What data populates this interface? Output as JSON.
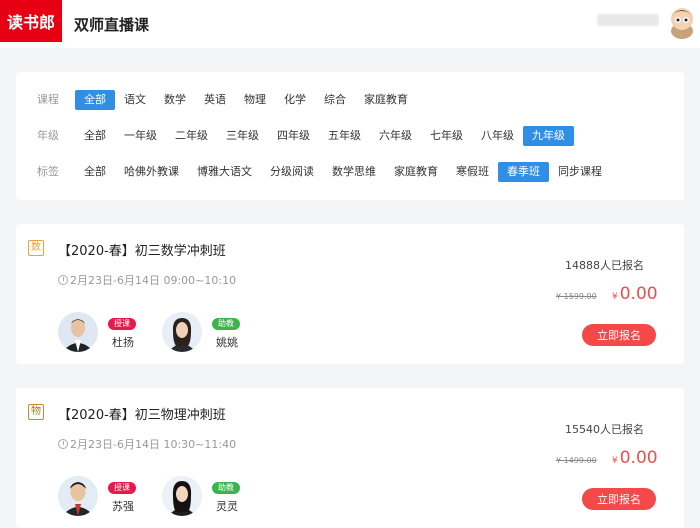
{
  "header": {
    "logo_text": "读书郎",
    "title": "双师直播课"
  },
  "filters": [
    {
      "label": "课程",
      "options": [
        "全部",
        "语文",
        "数学",
        "英语",
        "物理",
        "化学",
        "综合",
        "家庭教育"
      ],
      "selected": "全部"
    },
    {
      "label": "年级",
      "options": [
        "全部",
        "一年级",
        "二年级",
        "三年级",
        "四年级",
        "五年级",
        "六年级",
        "七年级",
        "八年级",
        "九年级"
      ],
      "selected": "九年级"
    },
    {
      "label": "标签",
      "options": [
        "全部",
        "哈佛外教课",
        "博雅大语文",
        "分级阅读",
        "数学思维",
        "家庭教育",
        "寒假班",
        "春季班",
        "同步课程"
      ],
      "selected": "春季班"
    }
  ],
  "courses": [
    {
      "subject": "数",
      "title": "【2020-春】初三数学冲刺班",
      "time": "2月23日-6月14日 09:00~10:10",
      "enrolled": "14888人已报名",
      "original_price": "¥ 1599.00",
      "currency": "¥",
      "price": "0.00",
      "enroll_label": "立即报名",
      "teachers": [
        {
          "role": "授课",
          "name": "杜扬"
        },
        {
          "role": "助教",
          "name": "姚姚"
        }
      ]
    },
    {
      "subject": "物",
      "title": "【2020-春】初三物理冲刺班",
      "time": "2月23日-6月14日 10:30~11:40",
      "enrolled": "15540人已报名",
      "original_price": "¥ 1499.00",
      "currency": "¥",
      "price": "0.00",
      "enroll_label": "立即报名",
      "teachers": [
        {
          "role": "授课",
          "name": "苏强"
        },
        {
          "role": "助教",
          "name": "灵灵"
        }
      ]
    }
  ],
  "colors": {
    "brand": "#e60012",
    "accent": "#2f8ee6",
    "price": "#f04d4d",
    "tag_teach": "#e6194b",
    "tag_assist": "#3cb44b"
  }
}
